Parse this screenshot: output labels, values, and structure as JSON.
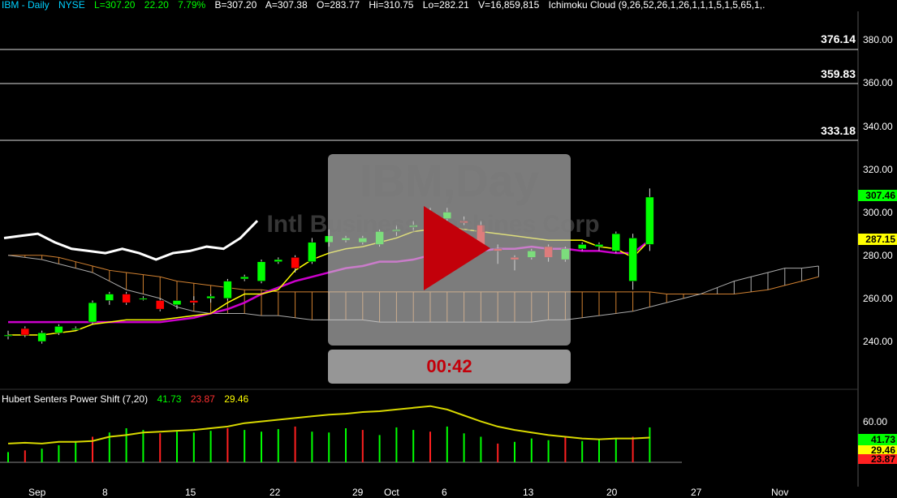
{
  "header": {
    "symbol": "IBM - Daily",
    "exchange": "NYSE",
    "last": "L=307.20",
    "change": "22.20",
    "pct": "7.79%",
    "bid": "B=307.20",
    "ask": "A=307.38",
    "open": "O=283.77",
    "high": "Hi=310.75",
    "low": "Lo=282.21",
    "volume": "V=16,859,815",
    "study": "Ichimoku Cloud (9,26,52,26,1,26,1,1,1,5,1,5,65,1,."
  },
  "watermark": {
    "title": "IBM,Day",
    "subtitle": "Intl Business Machines Corp"
  },
  "video": {
    "timer": "00:42"
  },
  "levels": [
    "376.14",
    "359.83",
    "333.18"
  ],
  "price_axis": [
    "380.00",
    "360.00",
    "340.00",
    "320.00",
    "300.00",
    "280.00",
    "260.00",
    "240.00"
  ],
  "price_tags": {
    "last": "307.46",
    "kijun": "287.15"
  },
  "indicator": {
    "name": "Hubert Senters Power Shift (7,20)",
    "v1": "41.73",
    "v2": "23.87",
    "v3": "29.46",
    "axis": "60.00",
    "tag1": "41.73",
    "tag2": "29.46",
    "tag3": "23.87"
  },
  "x_axis": [
    "Sep",
    "8",
    "15",
    "22",
    "29",
    "Oct",
    "6",
    "13",
    "20",
    "27",
    "Nov"
  ],
  "colors": {
    "up": "#00ff00",
    "down": "#ff0000",
    "tenkan": "#ffff00",
    "kijun": "#cc00cc",
    "play": "#c3000a"
  },
  "chart_data": {
    "type": "candlestick",
    "ylim": [
      220,
      385
    ],
    "candles": [
      {
        "o": 243,
        "h": 245,
        "l": 241,
        "c": 243
      },
      {
        "o": 246,
        "h": 247,
        "l": 242,
        "c": 243
      },
      {
        "o": 240,
        "h": 245,
        "l": 239,
        "c": 244
      },
      {
        "o": 244,
        "h": 248,
        "l": 243,
        "c": 247
      },
      {
        "o": 246,
        "h": 247,
        "l": 245,
        "c": 246
      },
      {
        "o": 249,
        "h": 259,
        "l": 248,
        "c": 258
      },
      {
        "o": 259,
        "h": 263,
        "l": 257,
        "c": 262
      },
      {
        "o": 262,
        "h": 263,
        "l": 257,
        "c": 258
      },
      {
        "o": 260,
        "h": 261,
        "l": 259,
        "c": 260
      },
      {
        "o": 259,
        "h": 260,
        "l": 254,
        "c": 255
      },
      {
        "o": 257,
        "h": 259,
        "l": 255,
        "c": 259
      },
      {
        "o": 259,
        "h": 261,
        "l": 257,
        "c": 258
      },
      {
        "o": 260,
        "h": 262,
        "l": 258,
        "c": 261
      },
      {
        "o": 260,
        "h": 269,
        "l": 259,
        "c": 268
      },
      {
        "o": 269,
        "h": 271,
        "l": 268,
        "c": 270
      },
      {
        "o": 268,
        "h": 278,
        "l": 267,
        "c": 277
      },
      {
        "o": 277,
        "h": 279,
        "l": 276,
        "c": 278
      },
      {
        "o": 279,
        "h": 280,
        "l": 272,
        "c": 274
      },
      {
        "o": 277,
        "h": 288,
        "l": 276,
        "c": 286
      },
      {
        "o": 286,
        "h": 292,
        "l": 284,
        "c": 289
      },
      {
        "o": 287,
        "h": 289,
        "l": 286,
        "c": 288
      },
      {
        "o": 286,
        "h": 289,
        "l": 285,
        "c": 288
      },
      {
        "o": 285,
        "h": 292,
        "l": 284,
        "c": 291
      },
      {
        "o": 291,
        "h": 294,
        "l": 289,
        "c": 292
      },
      {
        "o": 293,
        "h": 296,
        "l": 291,
        "c": 294
      },
      {
        "o": 300,
        "h": 302,
        "l": 298,
        "c": 300
      },
      {
        "o": 297,
        "h": 302,
        "l": 296,
        "c": 300
      },
      {
        "o": 296,
        "h": 298,
        "l": 294,
        "c": 295
      },
      {
        "o": 294,
        "h": 296,
        "l": 283,
        "c": 284
      },
      {
        "o": 283,
        "h": 285,
        "l": 276,
        "c": 282
      },
      {
        "o": 279,
        "h": 280,
        "l": 273,
        "c": 278
      },
      {
        "o": 279,
        "h": 283,
        "l": 278,
        "c": 282
      },
      {
        "o": 284,
        "h": 285,
        "l": 277,
        "c": 279
      },
      {
        "o": 278,
        "h": 284,
        "l": 277,
        "c": 283
      },
      {
        "o": 283,
        "h": 286,
        "l": 282,
        "c": 285
      },
      {
        "o": 284,
        "h": 286,
        "l": 282,
        "c": 285
      },
      {
        "o": 282,
        "h": 291,
        "l": 281,
        "c": 290
      },
      {
        "o": 268,
        "h": 290,
        "l": 264,
        "c": 288
      },
      {
        "o": 285,
        "h": 311,
        "l": 282,
        "c": 307
      }
    ],
    "tenkan": [
      243,
      243,
      243,
      244,
      245,
      248,
      249,
      250,
      250,
      250,
      251,
      252,
      253,
      258,
      262,
      262,
      264,
      273,
      278,
      281,
      283,
      284,
      286,
      288,
      291,
      292,
      293,
      292,
      291,
      290,
      289,
      288,
      287,
      287,
      287,
      284,
      283,
      279,
      287
    ],
    "kijun": [
      249,
      249,
      249,
      249,
      249,
      249,
      249,
      249,
      249,
      249,
      250,
      251,
      253,
      255,
      258,
      262,
      265,
      268,
      270,
      272,
      274,
      275,
      277,
      277,
      278,
      280,
      281,
      281,
      282,
      283,
      283,
      284,
      283,
      283,
      282,
      282,
      281,
      281,
      287
    ],
    "power_shift": {
      "green_line": [
        22,
        23,
        22,
        24,
        24,
        25,
        30,
        32,
        35,
        36,
        37,
        38,
        40,
        42,
        46,
        48,
        50,
        52,
        54,
        56,
        57,
        59,
        60,
        62,
        64,
        66,
        62,
        55,
        48,
        42,
        38,
        35,
        32,
        30,
        28,
        27,
        28,
        28,
        29
      ],
      "histogram": [
        12,
        14,
        16,
        20,
        25,
        30,
        35,
        40,
        38,
        34,
        36,
        35,
        37,
        40,
        38,
        36,
        39,
        42,
        36,
        35,
        40,
        38,
        32,
        41,
        38,
        36,
        42,
        34,
        30,
        22,
        24,
        28,
        26,
        30,
        25,
        27,
        28,
        30,
        41
      ]
    }
  }
}
